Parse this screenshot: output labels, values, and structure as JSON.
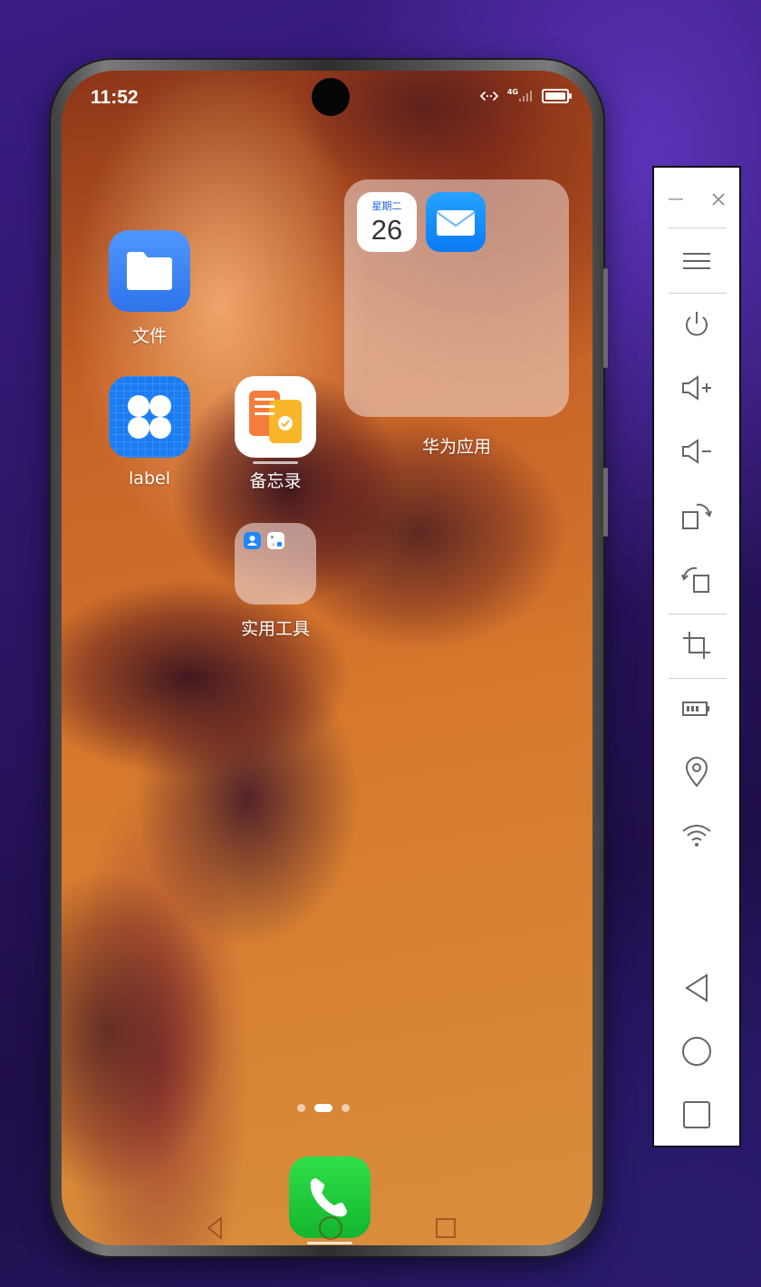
{
  "status_bar": {
    "time": "11:52",
    "network": "4G"
  },
  "apps": {
    "files": {
      "label": "文件",
      "icon": "folder-icon"
    },
    "label_app": {
      "label": "label",
      "icon": "grid-app-icon"
    },
    "memo": {
      "label": "备忘录",
      "icon": "notepad-icon"
    },
    "tools_folder": {
      "label": "实用工具"
    },
    "huawei_folder": {
      "label": "华为应用",
      "calendar": {
        "weekday": "星期二",
        "day": "26"
      },
      "mail_icon": "mail-icon"
    },
    "phone": {
      "icon": "phone-icon"
    }
  },
  "page_indicator": {
    "count": 3,
    "active": 2
  },
  "colors": {
    "files_blue": "#3d85f5",
    "phone_green": "#1fc43a",
    "memo_orange": "#f47c3c",
    "memo_yellow": "#f8b62a",
    "mail_blue": "#0a84ff"
  },
  "sidebar": {
    "items": [
      "minimize-icon",
      "close-icon",
      "menu-icon",
      "power-icon",
      "volume-up-icon",
      "volume-down-icon",
      "rotate-right-icon",
      "rotate-left-icon",
      "crop-icon",
      "battery-icon",
      "location-icon",
      "wifi-icon",
      "back-icon",
      "home-icon",
      "recents-icon"
    ]
  }
}
